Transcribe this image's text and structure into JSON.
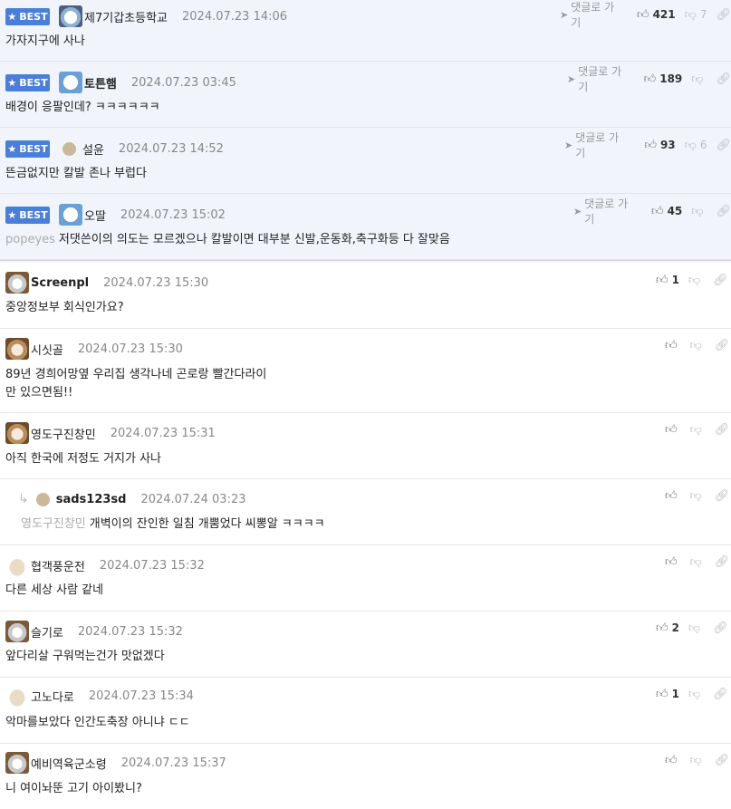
{
  "labels": {
    "best": "BEST",
    "goto": "댓글로 가기"
  },
  "best_comments": [
    {
      "nick": "제7기갑초등학교",
      "date": "2024.07.23 14:06",
      "text": "가자지구에 사나",
      "mention": "",
      "up": "421",
      "down": "7"
    },
    {
      "nick": "토튼햄",
      "date": "2024.07.23 03:45",
      "text": "배경이 응팔인데? ㅋㅋㅋㅋㅋㅋ",
      "mention": "",
      "up": "189",
      "down": ""
    },
    {
      "nick": "설윤",
      "date": "2024.07.23 14:52",
      "text": "뜬금없지만 칼발 존나 부럽다",
      "mention": "",
      "up": "93",
      "down": "6"
    },
    {
      "nick": "오딸",
      "date": "2024.07.23 15:02",
      "text": "저댓쓴이의 의도는 모르겠으나 칼발이면 대부분 신발,운동화,축구화등 다 잘맞음",
      "mention": "popeyes",
      "up": "45",
      "down": ""
    }
  ],
  "comments": [
    {
      "nick": "Screenpl",
      "date": "2024.07.23 15:30",
      "text": "중앙정보부 회식인가요?",
      "mention": "",
      "up": "1"
    },
    {
      "nick": "시싯골",
      "date": "2024.07.23 15:30",
      "text": "89년 경희어망옆 우리집 생각나네 곤로랑 빨간다라이",
      "text2": "만 있으면됨!!",
      "mention": "",
      "up": ""
    },
    {
      "nick": "영도구진창민",
      "date": "2024.07.23 15:31",
      "text": "아직 한국에 저정도 거지가 사나",
      "mention": "",
      "up": ""
    },
    {
      "nick": "sads123sd",
      "date": "2024.07.24 03:23",
      "text": "개벽이의 잔인한 일침 개뿜었다 씨뽕알 ㅋㅋㅋㅋ",
      "mention": "영도구진창민",
      "up": ""
    },
    {
      "nick": "협객풍운전",
      "date": "2024.07.23 15:32",
      "text": "다른 세상 사람 같네",
      "mention": "",
      "up": ""
    },
    {
      "nick": "슬기로",
      "date": "2024.07.23 15:32",
      "text": "앞다리살 구워먹는건가 맛없겠다",
      "mention": "",
      "up": "2"
    },
    {
      "nick": "고노다로",
      "date": "2024.07.23 15:34",
      "text": "악마를보았다 인간도축장 아니냐 ㄷㄷ",
      "mention": "",
      "up": "1"
    },
    {
      "nick": "예비역육군소령",
      "date": "2024.07.23 15:37",
      "text": "니 여이놔뚠 고기 아이봤니?",
      "mention": "",
      "up": ""
    }
  ],
  "icons": {
    "best": "star-icon",
    "goto": "send-arrow-icon",
    "up": "thumbs-up-icon",
    "down": "thumbs-down-icon",
    "share": "link-icon",
    "reply": "reply-arrow-icon"
  }
}
